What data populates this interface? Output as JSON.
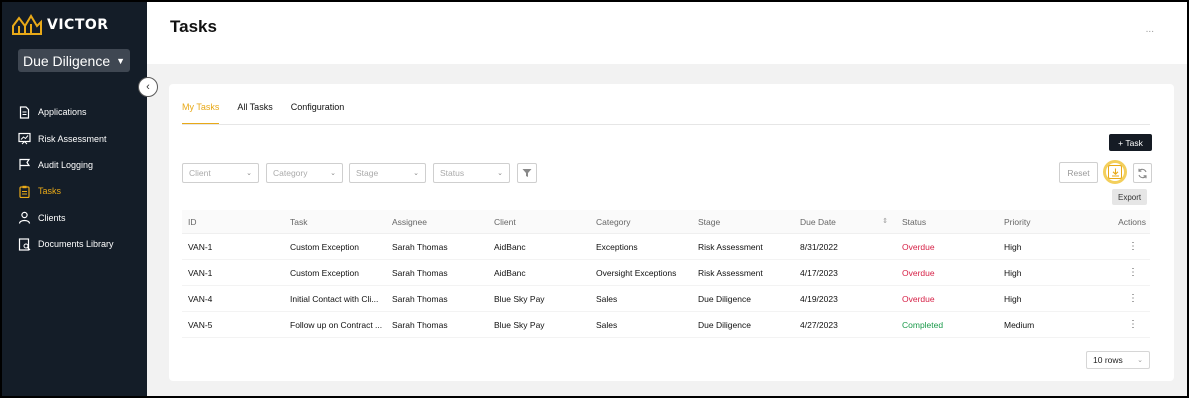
{
  "brand": {
    "name": "VICTOR",
    "accent": "#e8a918",
    "sidebar_bg": "#141d28"
  },
  "module": {
    "label": "Due Diligence"
  },
  "nav": [
    {
      "label": "Applications",
      "icon": "document-icon",
      "active": false
    },
    {
      "label": "Risk Assessment",
      "icon": "chart-icon",
      "active": false
    },
    {
      "label": "Audit Logging",
      "icon": "flag-icon",
      "active": false
    },
    {
      "label": "Tasks",
      "icon": "clipboard-icon",
      "active": true
    },
    {
      "label": "Clients",
      "icon": "user-icon",
      "active": false
    },
    {
      "label": "Documents Library",
      "icon": "library-icon",
      "active": false
    }
  ],
  "header": {
    "title": "Tasks",
    "more": "..."
  },
  "tabs": [
    {
      "label": "My Tasks",
      "active": true
    },
    {
      "label": "All Tasks",
      "active": false
    },
    {
      "label": "Configuration",
      "active": false
    }
  ],
  "toolbar": {
    "add_task": "+ Task",
    "reset": "Reset",
    "export_tooltip": "Export"
  },
  "filters": [
    {
      "placeholder": "Client"
    },
    {
      "placeholder": "Category"
    },
    {
      "placeholder": "Stage"
    },
    {
      "placeholder": "Status"
    }
  ],
  "table": {
    "columns": [
      "ID",
      "Task",
      "Assignee",
      "Client",
      "Category",
      "Stage",
      "Due Date",
      "Status",
      "Priority",
      "Actions"
    ],
    "rows": [
      {
        "id": "VAN-1",
        "task": "Custom Exception",
        "assignee": "Sarah Thomas",
        "client": "AidBanc",
        "category": "Exceptions",
        "stage": "Risk Assessment",
        "due": "8/31/2022",
        "status": "Overdue",
        "priority": "High"
      },
      {
        "id": "VAN-1",
        "task": "Custom Exception",
        "assignee": "Sarah Thomas",
        "client": "AidBanc",
        "category": "Oversight Exceptions",
        "stage": "Risk Assessment",
        "due": "4/17/2023",
        "status": "Overdue",
        "priority": "High"
      },
      {
        "id": "VAN-4",
        "task": "Initial Contact with Cli...",
        "assignee": "Sarah Thomas",
        "client": "Blue Sky Pay",
        "category": "Sales",
        "stage": "Due Diligence",
        "due": "4/19/2023",
        "status": "Overdue",
        "priority": "High"
      },
      {
        "id": "VAN-5",
        "task": "Follow up on Contract ...",
        "assignee": "Sarah Thomas",
        "client": "Blue Sky Pay",
        "category": "Sales",
        "stage": "Due Diligence",
        "due": "4/27/2023",
        "status": "Completed",
        "priority": "Medium"
      }
    ]
  },
  "pagination": {
    "rows_label": "10 rows"
  },
  "colors": {
    "overdue": "#d61f45",
    "completed": "#1a9a4a"
  }
}
